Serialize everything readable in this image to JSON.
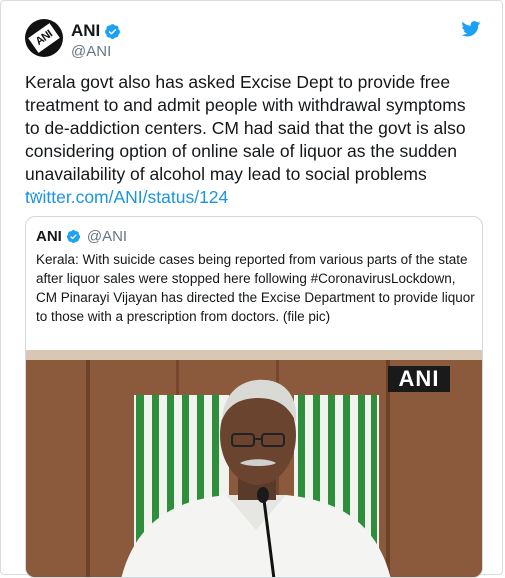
{
  "tweet": {
    "name": "ANI",
    "handle": "@ANI",
    "avatar_text": "ANI",
    "text": "Kerala govt also has asked Excise Dept to provide free treatment to and admit people with withdrawal symptoms to de-addiction centers. CM had said that the govt is also considering option of online sale of liquor as the sudden unavailability of alcohol may lead to social problems ",
    "link_text": "twitter.com/ANI/status/124",
    "ellipsis": "…"
  },
  "quoted_tweet": {
    "name": "ANI",
    "handle": "@ANI",
    "text": "Kerala: With suicide cases being reported from various parts of the state after liquor sales were stopped here following #CoronavirusLockdown, CM Pinarayi Vijayan has directed the Excise Department to provide liquor to those with a prescription from doctors. (file pic)",
    "image_watermark": "ANI"
  },
  "colors": {
    "link": "#1b95e0",
    "verified": "#1da1f2",
    "handle": "#657786",
    "twitter_bird": "#1da1f2"
  },
  "icons": [
    "verified-badge-icon",
    "twitter-bird-icon"
  ]
}
